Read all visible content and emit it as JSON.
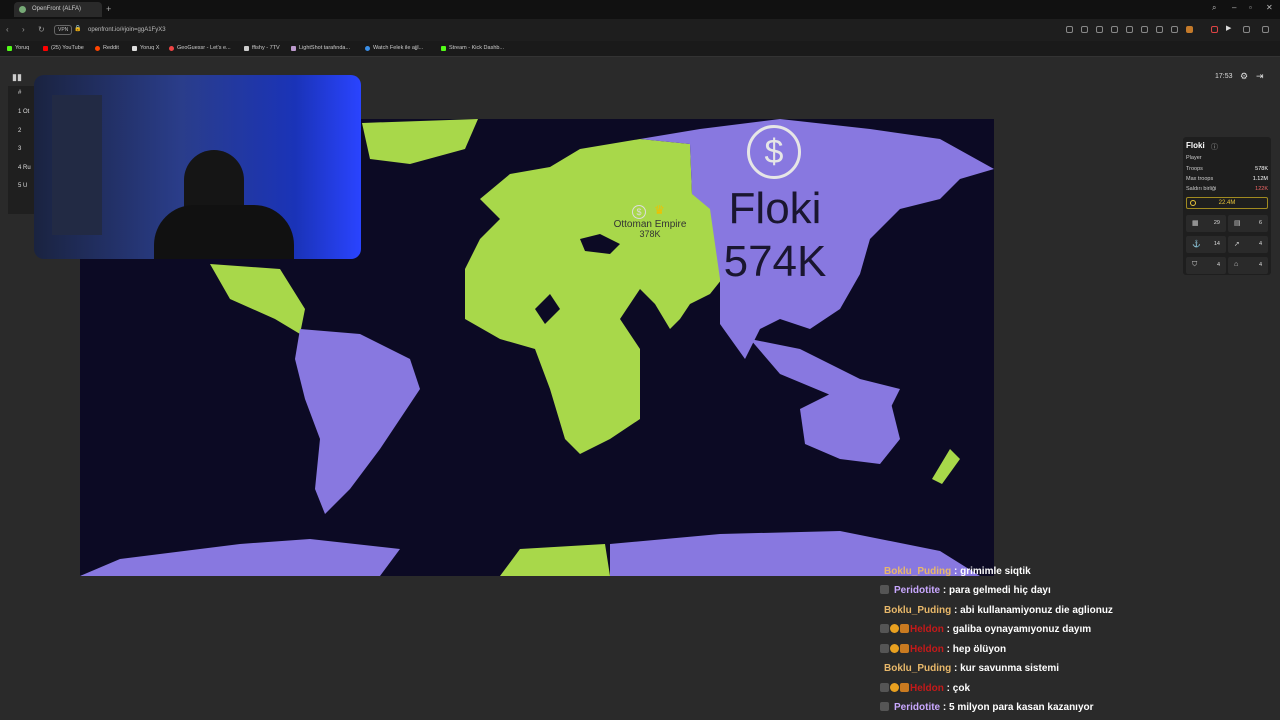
{
  "browser": {
    "tab_title": "OpenFront (ALFA)",
    "vpn_label": "VPN",
    "url": "openfront.io/#join=ggA1FyX3",
    "bookmarks": [
      "Yoruq",
      "(25) YouTube",
      "Reddit",
      "Yoruq X",
      "GeoGuessr - Let's e...",
      "ffishy - 7TV",
      "LightShot tarafında...",
      "Watch Felek ile ajjl...",
      "Stream - Kick Dashb..."
    ]
  },
  "leaderboard": {
    "header": "#",
    "rows": [
      {
        "rank": "1",
        "name": "Ot"
      },
      {
        "rank": "2",
        "name": ""
      },
      {
        "rank": "3",
        "name": ""
      },
      {
        "rank": "4",
        "name": "Ru"
      },
      {
        "rank": "5",
        "name": "U"
      }
    ]
  },
  "game": {
    "timer": "17:53",
    "map_player": {
      "name": "Floki",
      "troops": "574K"
    },
    "map_other": {
      "name": "Ottoman Empire",
      "troops": "378K"
    }
  },
  "player_panel": {
    "name": "Floki",
    "role": "Player",
    "rows": [
      {
        "label": "Troops",
        "value": "578K"
      },
      {
        "label": "Max troops",
        "value": "1.12M"
      },
      {
        "label": "Saldırı birliği",
        "value": "122K"
      }
    ],
    "gold": "22.4M",
    "buildings": [
      {
        "icon": "city",
        "count": "29"
      },
      {
        "icon": "factory",
        "count": "6"
      },
      {
        "icon": "port",
        "count": "14"
      },
      {
        "icon": "missile",
        "count": "4"
      },
      {
        "icon": "defense",
        "count": "4"
      },
      {
        "icon": "sam",
        "count": "4"
      }
    ]
  },
  "chat": [
    {
      "user": "Boklu_Puding",
      "text": ": grimimle siqtik",
      "color": "#e8b86a",
      "badges": 0
    },
    {
      "user": "Peridotite",
      "text": ": para gelmedi hiç dayı",
      "color": "#c9a8ff",
      "badges": 1
    },
    {
      "user": "Boklu_Puding",
      "text": ": abi kullanamiyonuz die aglionuz",
      "color": "#e8b86a",
      "badges": 0
    },
    {
      "user": "Heldon",
      "text": ": galiba oynayamıyonuz dayım",
      "color": "#c41a1a",
      "badges": 3
    },
    {
      "user": "Heldon",
      "text": ": hep ölüyon",
      "color": "#c41a1a",
      "badges": 3
    },
    {
      "user": "Boklu_Puding",
      "text": ": kur savunma sistemi",
      "color": "#e8b86a",
      "badges": 0
    },
    {
      "user": "Heldon",
      "text": ": çok",
      "color": "#c41a1a",
      "badges": 3
    },
    {
      "user": "Peridotite",
      "text": ": 5 milyon para kasan kazanıyor",
      "color": "#c9a8ff",
      "badges": 1
    }
  ],
  "colors": {
    "ocean": "#0c0a24",
    "player_territory": "#8878e0",
    "ottoman_territory": "#a8d84a",
    "gold": "#e8c53a"
  }
}
